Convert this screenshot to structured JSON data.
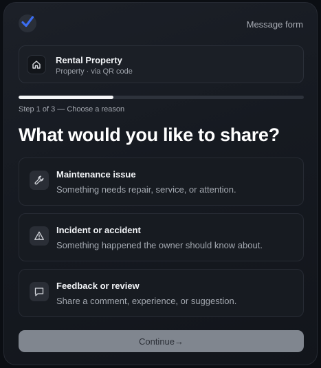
{
  "header": {
    "logo_icon": "checkmark-icon",
    "brand_label": "Message form",
    "accent_color": "#3b6df0"
  },
  "property": {
    "icon": "home-icon",
    "name": "Rental Property",
    "subtitle": "Property · via QR code"
  },
  "progress": {
    "current_step": 1,
    "total_steps": 3,
    "fraction": 0.333,
    "label": "Step 1 of 3 — Choose a reason"
  },
  "question": "What would you like to share?",
  "options": [
    {
      "icon": "wrench-icon",
      "title": "Maintenance issue",
      "description": "Something needs repair, service, or attention."
    },
    {
      "icon": "warning-triangle-icon",
      "title": "Incident or accident",
      "description": "Something happened the owner should know about."
    },
    {
      "icon": "chat-bubble-icon",
      "title": "Feedback or review",
      "description": "Share a comment, experience, or suggestion."
    }
  ],
  "continue_label": "Continue→"
}
